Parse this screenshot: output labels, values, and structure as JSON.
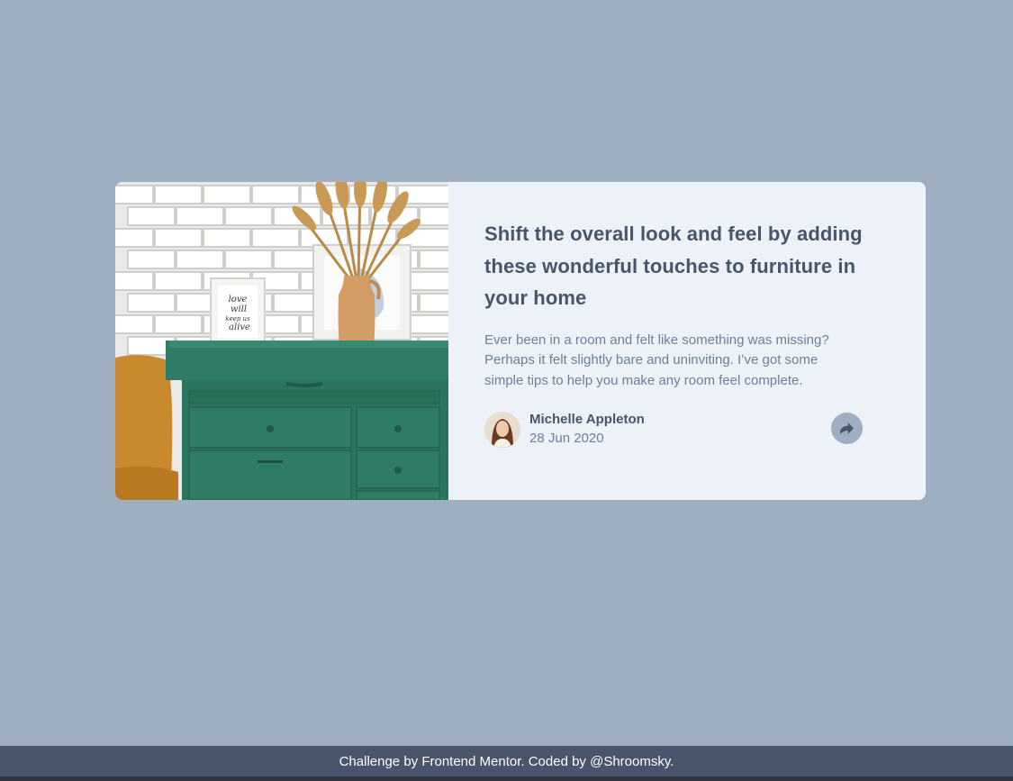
{
  "article": {
    "title": "Shift the overall look and feel by adding these wonderful touches to furniture in your home",
    "description": "Ever been in a room and felt like something was missing? Perhaps it felt slightly bare and uninviting. I’ve got some simple tips to help you make any room feel complete.",
    "author": {
      "name": "Michelle Appleton",
      "date": "28 Jun 2020"
    },
    "frame_text": [
      "love",
      "will",
      "keep us",
      "alive"
    ]
  },
  "icons": {
    "share": "share-icon"
  },
  "footer": {
    "text": "Challenge by Frontend Mentor. Coded by @Shroomsky."
  },
  "colors": {
    "background": "#9eafc2",
    "card": "#ecf2f8",
    "heading": "#48556a",
    "body_text": "#6e8098",
    "footer": "#48556a"
  }
}
